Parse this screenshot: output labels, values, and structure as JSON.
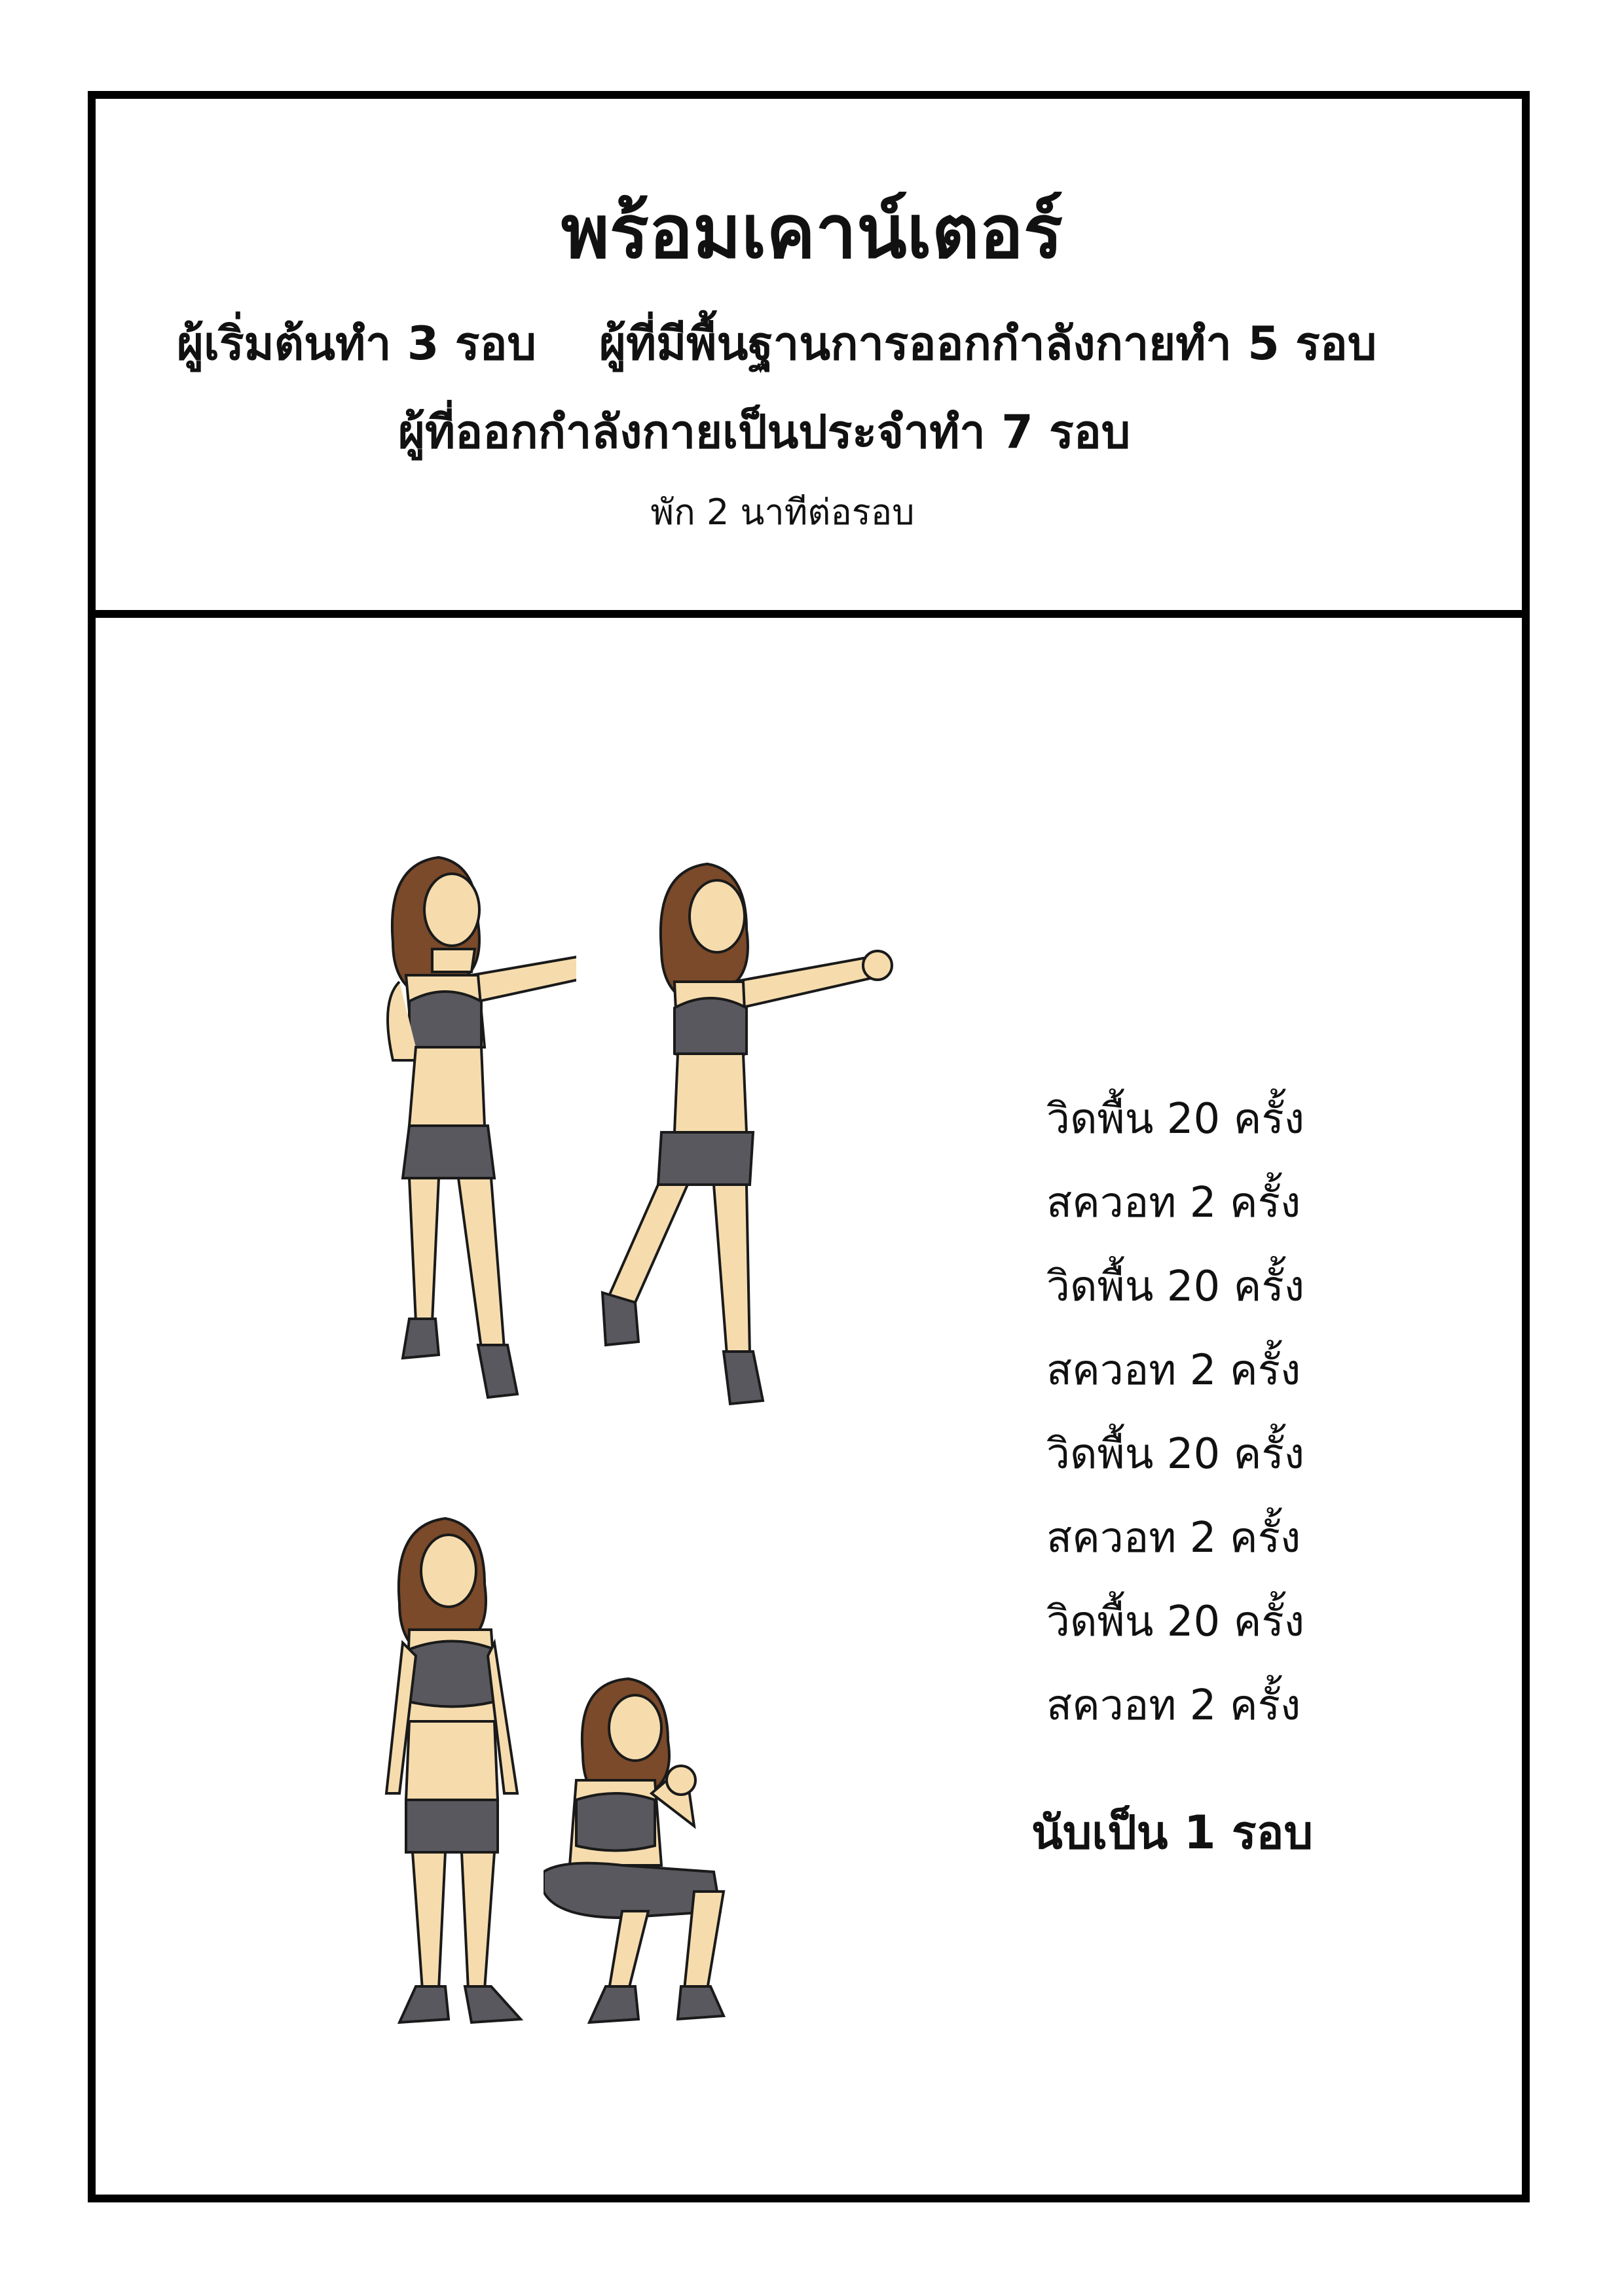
{
  "header": {
    "title": "พร้อมเคาน์เตอร์",
    "beginner": "ผู้เริ่มต้นทำ 3 รอบ",
    "intermediate": "ผู้ที่มีพื้นฐานการออกกำลังกายทำ 5 รอบ",
    "regular": "ผู้ที่ออกกำลังกายเป็นประจำทำ 7 รอบ",
    "rest": "พัก 2 นาทีต่อรอบ"
  },
  "exercise_list": [
    "วิดพื้น 20 ครั้ง",
    "สควอท 2 ครั้ง",
    "วิดพื้น 20 ครั้ง",
    "สควอท 2 ครั้ง",
    "วิดพื้น 20 ครั้ง",
    "สควอท 2 ครั้ง",
    "วิดพื้น 20 ครั้ง",
    "สควอท 2 ครั้ง"
  ],
  "summary": "นับเป็น 1 รอบ",
  "colors": {
    "skin": "#f6dcad",
    "outfit": "#58585e",
    "hair": "#7a4a2a",
    "outline": "#1a1a1a"
  }
}
